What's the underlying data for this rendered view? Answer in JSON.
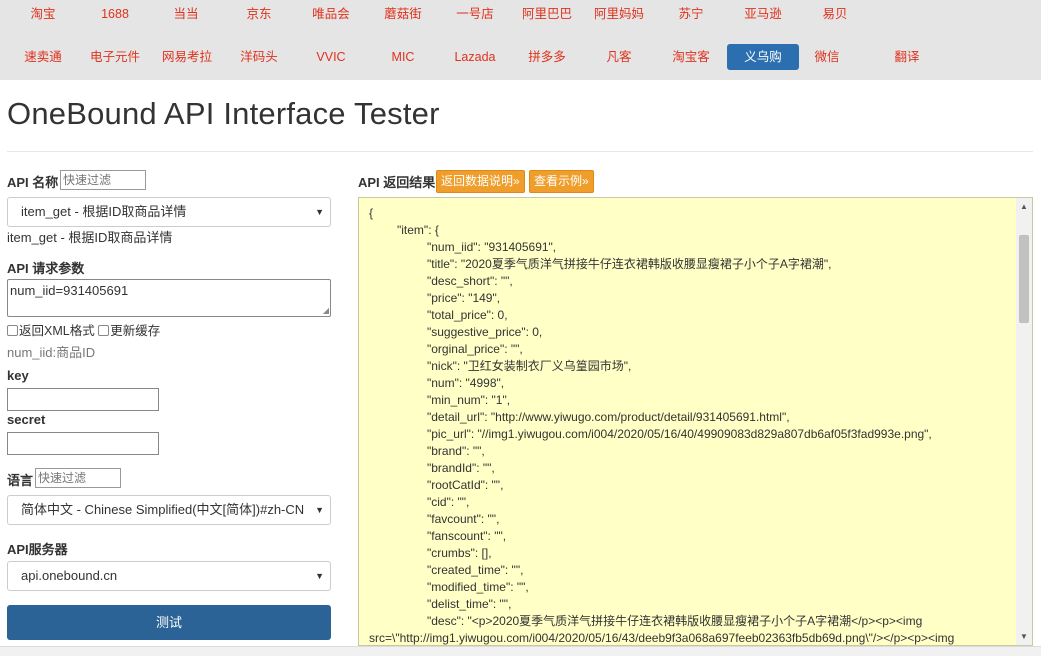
{
  "nav": {
    "row1": [
      "淘宝",
      "1688",
      "当当",
      "京东",
      "唯品会",
      "蘑菇街",
      "一号店",
      "阿里巴巴",
      "阿里妈妈",
      "苏宁",
      "亚马逊",
      "易贝"
    ],
    "row2": [
      "速卖通",
      "电子元件",
      "网易考拉",
      "洋码头",
      "VVIC",
      "MIC",
      "Lazada",
      "拼多多",
      "凡客",
      "淘宝客",
      "义乌购",
      "微信",
      "翻译"
    ],
    "active": "义乌购"
  },
  "title": "OneBound API Interface Tester",
  "form": {
    "api_name_label": "API 名称",
    "filter_placeholder": "快速过滤",
    "api_selected": "item_get - 根据ID取商品详情",
    "api_desc": "item_get - 根据ID取商品详情",
    "params_label": "API 请求参数",
    "params_value": "num_iid=931405691",
    "opt_xml": "返回XML格式",
    "opt_cache": "更新缓存",
    "param_hint": "num_iid:商品ID",
    "key_label": "key",
    "secret_label": "secret",
    "lang_label": "语言",
    "lang_selected": "简体中文 - Chinese Simplified(中文[简体])#zh-CN",
    "server_label": "API服务器",
    "server_selected": "api.onebound.cn",
    "test_button": "测试"
  },
  "result": {
    "label": "API 返回结果",
    "btn_doc": "返回数据说明»",
    "btn_example": "查看示例»",
    "json_lines": [
      "{",
      "\"item\": {",
      "\"num_iid\": \"931405691\",",
      "\"title\": \"2020夏季气质洋气拼接牛仔连衣裙韩版收腰显瘦裙子小个子A字裙潮\",",
      "\"desc_short\": \"\",",
      "\"price\": \"149\",",
      "\"total_price\": 0,",
      "\"suggestive_price\": 0,",
      "\"orginal_price\": \"\",",
      "\"nick\": \"卫红女装制衣厂义乌篁园市场\",",
      "\"num\": \"4998\",",
      "\"min_num\": \"1\",",
      "\"detail_url\": \"http://www.yiwugo.com/product/detail/931405691.html\",",
      "\"pic_url\": \"//img1.yiwugou.com/i004/2020/05/16/40/49909083d829a807db6af05f3fad993e.png\",",
      "\"brand\": \"\",",
      "\"brandId\": \"\",",
      "\"rootCatId\": \"\",",
      "\"cid\": \"\",",
      "\"favcount\": \"\",",
      "\"fanscount\": \"\",",
      "\"crumbs\": [],",
      "\"created_time\": \"\",",
      "\"modified_time\": \"\",",
      "\"delist_time\": \"\",",
      "\"desc\": \"<p>2020夏季气质洋气拼接牛仔连衣裙韩版收腰显瘦裙子小个子A字裙潮</p><p><img",
      "src=\\\"http://img1.yiwugou.com/i004/2020/05/16/43/deeb9f3a068a697feeb02363fb5db69d.png\\\"/></p><p><img"
    ]
  }
}
